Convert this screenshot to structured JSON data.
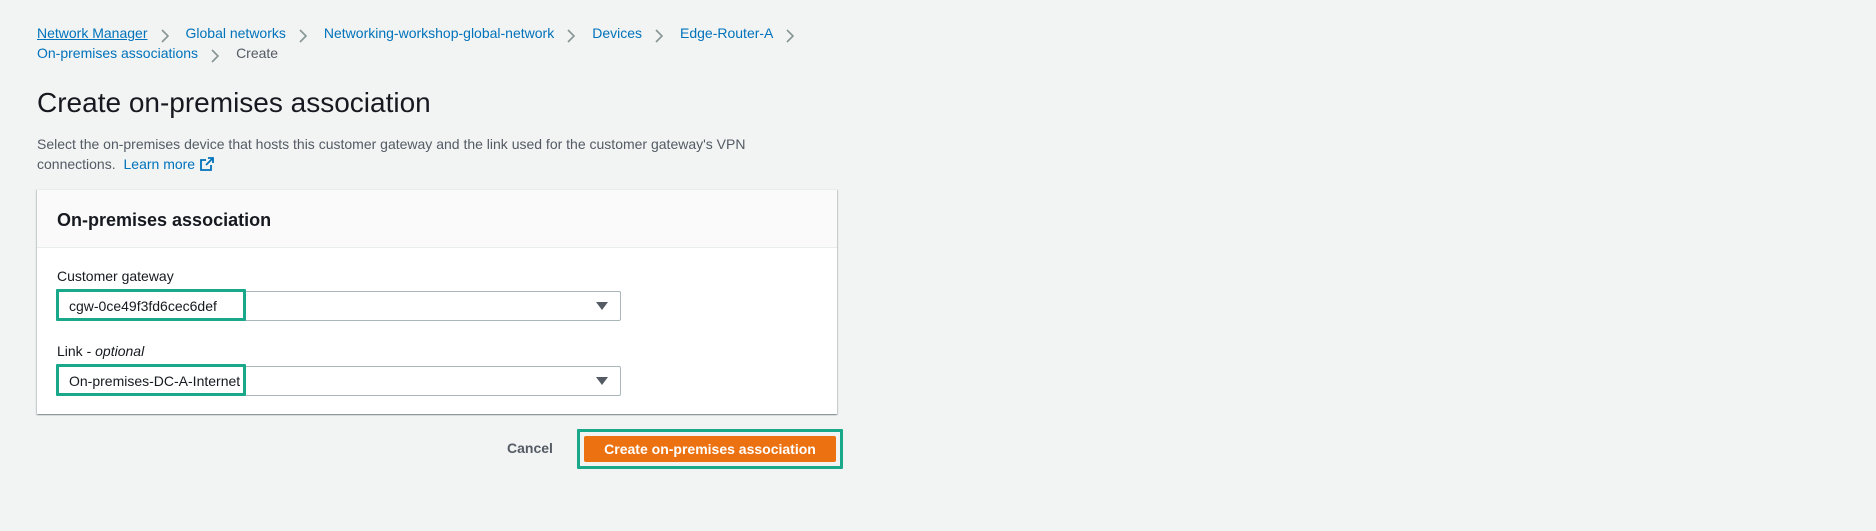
{
  "breadcrumb": {
    "items": [
      {
        "label": "Network Manager"
      },
      {
        "label": "Global networks"
      },
      {
        "label": "Networking-workshop-global-network"
      },
      {
        "label": "Devices"
      },
      {
        "label": "Edge-Router-A"
      },
      {
        "label": "On-premises associations"
      }
    ],
    "current": "Create"
  },
  "page": {
    "title": "Create on-premises association",
    "description": "Select the on-premises device that hosts this customer gateway and the link used for the customer gateway's VPN connections.",
    "learn_more": "Learn more"
  },
  "form": {
    "section_title": "On-premises association",
    "customer_gateway": {
      "label": "Customer gateway",
      "value": "cgw-0ce49f3fd6cec6def"
    },
    "link": {
      "label": "Link",
      "label_suffix": " - ",
      "optional_label": "optional",
      "value": "On-premises-DC-A-Internet"
    }
  },
  "actions": {
    "cancel_label": "Cancel",
    "submit_label": "Create on-premises association"
  },
  "colors": {
    "link": "#0073bb",
    "primary": "#ec7211",
    "highlight": "#1aa88a",
    "background": "#f2f3f3"
  },
  "icons": {
    "breadcrumb_separator": "chevron-right-icon",
    "external_link": "external-link-icon",
    "select_caret": "caret-down-icon"
  }
}
